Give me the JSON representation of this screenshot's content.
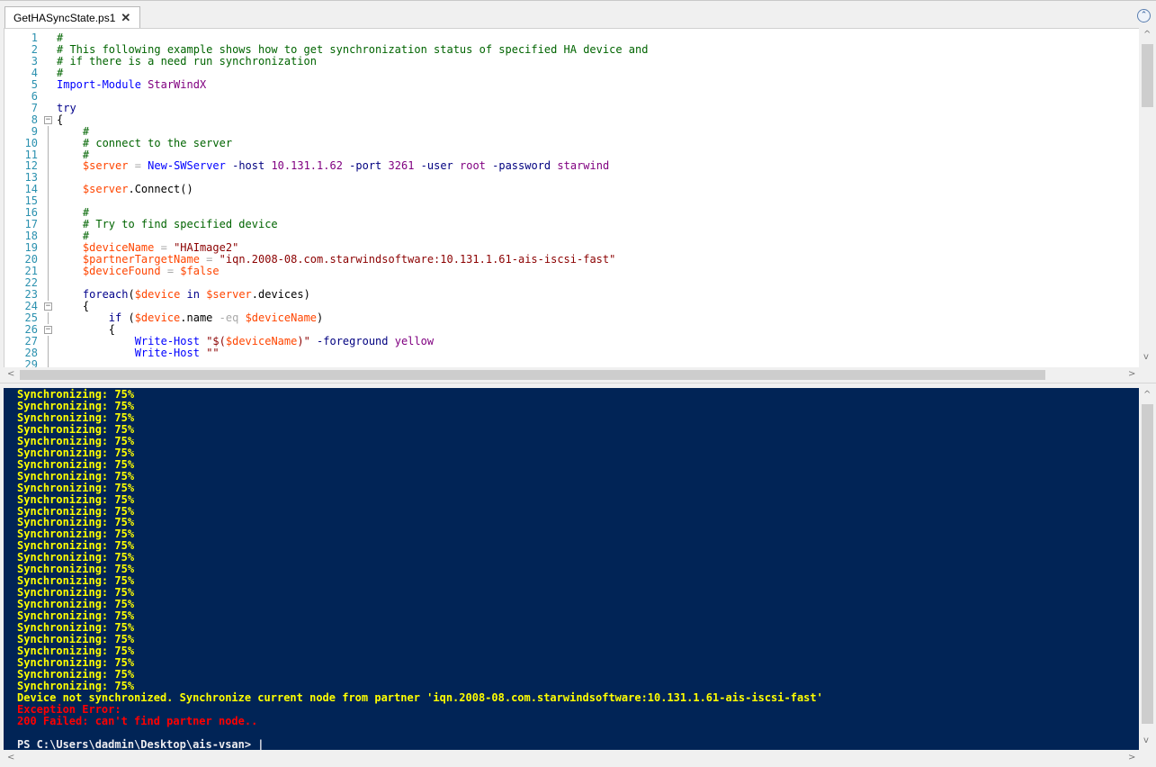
{
  "tab": {
    "title": "GetHASyncState.ps1",
    "close": "✕"
  },
  "editor": {
    "lines": [
      {
        "n": "1",
        "fold": "",
        "segs": [
          [
            "c-comment",
            "#"
          ]
        ]
      },
      {
        "n": "2",
        "fold": "",
        "segs": [
          [
            "c-comment",
            "# This following example shows how to get synchronization status of specified HA device and"
          ]
        ]
      },
      {
        "n": "3",
        "fold": "",
        "segs": [
          [
            "c-comment",
            "# if there is a need run synchronization"
          ]
        ]
      },
      {
        "n": "4",
        "fold": "",
        "segs": [
          [
            "c-comment",
            "#"
          ]
        ]
      },
      {
        "n": "5",
        "fold": "",
        "segs": [
          [
            "c-cmd",
            "Import-Module"
          ],
          [
            "c-type",
            " "
          ],
          [
            "c-num",
            "StarWindX"
          ]
        ]
      },
      {
        "n": "6",
        "fold": "",
        "segs": []
      },
      {
        "n": "7",
        "fold": "",
        "segs": [
          [
            "c-kw",
            "try"
          ]
        ]
      },
      {
        "n": "8",
        "fold": "box",
        "segs": [
          [
            "c-type",
            "{"
          ]
        ]
      },
      {
        "n": "9",
        "fold": "line",
        "segs": [
          [
            "c-comment",
            "    #"
          ]
        ]
      },
      {
        "n": "10",
        "fold": "line",
        "segs": [
          [
            "c-comment",
            "    # connect to the server"
          ]
        ]
      },
      {
        "n": "11",
        "fold": "line",
        "segs": [
          [
            "c-comment",
            "    #"
          ]
        ]
      },
      {
        "n": "12",
        "fold": "line",
        "segs": [
          [
            "c-var",
            "    $server"
          ],
          [
            "c-op",
            " = "
          ],
          [
            "c-cmd",
            "New-SWServer"
          ],
          [
            "c-param",
            " -host "
          ],
          [
            "c-num",
            "10.131.1.62"
          ],
          [
            "c-param",
            " -port "
          ],
          [
            "c-num",
            "3261"
          ],
          [
            "c-param",
            " -user "
          ],
          [
            "c-num",
            "root"
          ],
          [
            "c-param",
            " -password "
          ],
          [
            "c-num",
            "starwind"
          ]
        ]
      },
      {
        "n": "13",
        "fold": "line",
        "segs": []
      },
      {
        "n": "14",
        "fold": "line",
        "segs": [
          [
            "c-var",
            "    $server"
          ],
          [
            "c-type",
            ".Connect()"
          ]
        ]
      },
      {
        "n": "15",
        "fold": "line",
        "segs": []
      },
      {
        "n": "16",
        "fold": "line",
        "segs": [
          [
            "c-comment",
            "    #"
          ]
        ]
      },
      {
        "n": "17",
        "fold": "line",
        "segs": [
          [
            "c-comment",
            "    # Try to find specified device"
          ]
        ]
      },
      {
        "n": "18",
        "fold": "line",
        "segs": [
          [
            "c-comment",
            "    #"
          ]
        ]
      },
      {
        "n": "19",
        "fold": "line",
        "segs": [
          [
            "c-var",
            "    $deviceName"
          ],
          [
            "c-op",
            " = "
          ],
          [
            "c-str",
            "\"HAImage2\""
          ]
        ]
      },
      {
        "n": "20",
        "fold": "line",
        "segs": [
          [
            "c-var",
            "    $partnerTargetName"
          ],
          [
            "c-op",
            " = "
          ],
          [
            "c-str",
            "\"iqn.2008-08.com.starwindsoftware:10.131.1.61-ais-iscsi-fast\""
          ]
        ]
      },
      {
        "n": "21",
        "fold": "line",
        "segs": [
          [
            "c-var",
            "    $deviceFound"
          ],
          [
            "c-op",
            " = "
          ],
          [
            "c-var",
            "$false"
          ]
        ]
      },
      {
        "n": "22",
        "fold": "line",
        "segs": []
      },
      {
        "n": "23",
        "fold": "line",
        "segs": [
          [
            "c-kw",
            "    foreach"
          ],
          [
            "c-type",
            "("
          ],
          [
            "c-var",
            "$device"
          ],
          [
            "c-kw",
            " in "
          ],
          [
            "c-var",
            "$server"
          ],
          [
            "c-type",
            ".devices)"
          ]
        ]
      },
      {
        "n": "24",
        "fold": "box",
        "segs": [
          [
            "c-type",
            "    {"
          ]
        ]
      },
      {
        "n": "25",
        "fold": "line",
        "segs": [
          [
            "c-kw",
            "        if"
          ],
          [
            "c-type",
            " ("
          ],
          [
            "c-var",
            "$device"
          ],
          [
            "c-type",
            ".name "
          ],
          [
            "c-op",
            "-eq"
          ],
          [
            "c-type",
            " "
          ],
          [
            "c-var",
            "$deviceName"
          ],
          [
            "c-type",
            ")"
          ]
        ]
      },
      {
        "n": "26",
        "fold": "box",
        "segs": [
          [
            "c-type",
            "        {"
          ]
        ]
      },
      {
        "n": "27",
        "fold": "line",
        "segs": [
          [
            "c-cmd",
            "            Write-Host"
          ],
          [
            "c-type",
            " "
          ],
          [
            "c-str",
            "\"$("
          ],
          [
            "c-var",
            "$deviceName"
          ],
          [
            "c-str",
            ")\""
          ],
          [
            "c-param",
            " -foreground "
          ],
          [
            "c-num",
            "yellow"
          ]
        ]
      },
      {
        "n": "28",
        "fold": "line",
        "segs": [
          [
            "c-cmd",
            "            Write-Host"
          ],
          [
            "c-type",
            " "
          ],
          [
            "c-str",
            "\"\""
          ]
        ]
      },
      {
        "n": "29",
        "fold": "line",
        "segs": []
      }
    ]
  },
  "console": {
    "lines": [
      [
        "yellow",
        "Synchronizing: 75%"
      ],
      [
        "yellow",
        "Synchronizing: 75%"
      ],
      [
        "yellow",
        "Synchronizing: 75%"
      ],
      [
        "yellow",
        "Synchronizing: 75%"
      ],
      [
        "yellow",
        "Synchronizing: 75%"
      ],
      [
        "yellow",
        "Synchronizing: 75%"
      ],
      [
        "yellow",
        "Synchronizing: 75%"
      ],
      [
        "yellow",
        "Synchronizing: 75%"
      ],
      [
        "yellow",
        "Synchronizing: 75%"
      ],
      [
        "yellow",
        "Synchronizing: 75%"
      ],
      [
        "yellow",
        "Synchronizing: 75%"
      ],
      [
        "yellow",
        "Synchronizing: 75%"
      ],
      [
        "yellow",
        "Synchronizing: 75%"
      ],
      [
        "yellow",
        "Synchronizing: 75%"
      ],
      [
        "yellow",
        "Synchronizing: 75%"
      ],
      [
        "yellow",
        "Synchronizing: 75%"
      ],
      [
        "yellow",
        "Synchronizing: 75%"
      ],
      [
        "yellow",
        "Synchronizing: 75%"
      ],
      [
        "yellow",
        "Synchronizing: 75%"
      ],
      [
        "yellow",
        "Synchronizing: 75%"
      ],
      [
        "yellow",
        "Synchronizing: 75%"
      ],
      [
        "yellow",
        "Synchronizing: 75%"
      ],
      [
        "yellow",
        "Synchronizing: 75%"
      ],
      [
        "yellow",
        "Synchronizing: 75%"
      ],
      [
        "yellow",
        "Synchronizing: 75%"
      ],
      [
        "yellow",
        "Synchronizing: 75%"
      ],
      [
        "yellow",
        "Device not synchronized. Synchronize current node from partner 'iqn.2008-08.com.starwindsoftware:10.131.1.61-ais-iscsi-fast'"
      ],
      [
        "red",
        "Exception Error:"
      ],
      [
        "red",
        "200 Failed: can't find partner node.."
      ],
      [
        "white",
        ""
      ],
      [
        "white",
        "PS C:\\Users\\dadmin\\Desktop\\ais-vsan> |"
      ]
    ]
  },
  "icons": {
    "collapse": "⌃",
    "scroll_up": "^",
    "scroll_down": "v",
    "scroll_left": "<",
    "scroll_right": ">"
  }
}
